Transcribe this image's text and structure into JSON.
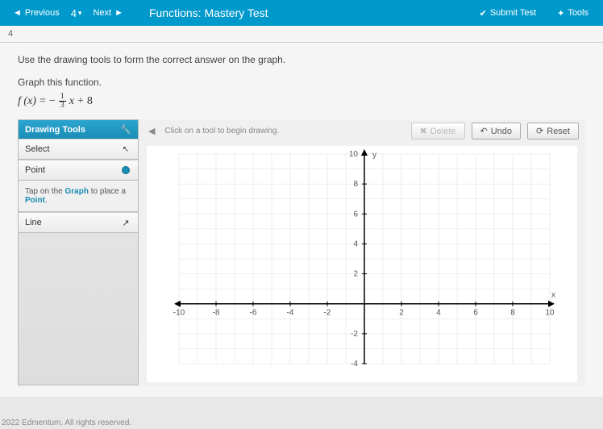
{
  "nav": {
    "prev": "Previous",
    "current": "4",
    "next": "Next"
  },
  "title": "Functions: Mastery Test",
  "actions": {
    "submit": "Submit Test",
    "tools": "Tools"
  },
  "step_num": "4",
  "instruction": "Use the drawing tools to form the correct answer on the graph.",
  "graph_label": "Graph this function.",
  "equation": {
    "lhs": "f (x)",
    "eq": "=",
    "neg": "−",
    "frac_num": "1",
    "frac_den": "3",
    "var": "x",
    "op": "+",
    "const": "8"
  },
  "tools_panel": {
    "header": "Drawing Tools",
    "items": {
      "select": "Select",
      "point": "Point",
      "line": "Line"
    },
    "hint_prefix": "Tap on the ",
    "hint_graph": "Graph",
    "hint_mid": " to place a ",
    "hint_point": "Point",
    "hint_end": "."
  },
  "canvas_bar": {
    "hint": "Click on a tool to begin drawing.",
    "delete": "Delete",
    "undo": "Undo",
    "reset": "Reset"
  },
  "footer": "2022 Edmentum. All rights reserved.",
  "chart_data": {
    "type": "scatter",
    "title": "",
    "xlabel": "x",
    "ylabel": "y",
    "xlim": [
      -10,
      10
    ],
    "ylim": [
      -4,
      10
    ],
    "xticks": [
      -10,
      -8,
      -6,
      -4,
      -2,
      2,
      4,
      6,
      8,
      10
    ],
    "yticks": [
      -4,
      -2,
      2,
      4,
      6,
      8,
      10
    ],
    "series": [],
    "grid": true
  }
}
